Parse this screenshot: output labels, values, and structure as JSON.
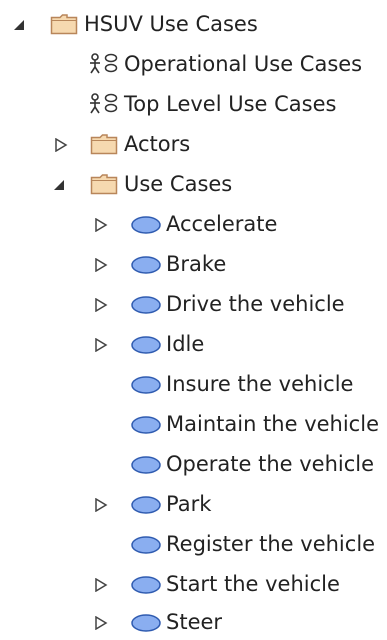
{
  "tree": {
    "root": {
      "label": "HSUV Use Cases",
      "expanded": true,
      "icon": "folder-icon",
      "children": {
        "operational": {
          "label": "Operational Use Cases",
          "icon": "use-case-diagram-icon"
        },
        "top_level": {
          "label": "Top Level Use Cases",
          "icon": "use-case-diagram-icon"
        },
        "actors": {
          "label": "Actors",
          "icon": "folder-icon",
          "expanded": false
        },
        "use_cases": {
          "label": "Use Cases",
          "icon": "folder-icon",
          "expanded": true,
          "items": [
            {
              "label": "Accelerate",
              "has_children": true
            },
            {
              "label": "Brake",
              "has_children": true
            },
            {
              "label": "Drive the vehicle",
              "has_children": true
            },
            {
              "label": "Idle",
              "has_children": true
            },
            {
              "label": "Insure the vehicle",
              "has_children": false
            },
            {
              "label": "Maintain the vehicle",
              "has_children": false
            },
            {
              "label": "Operate the vehicle",
              "has_children": false
            },
            {
              "label": "Park",
              "has_children": true
            },
            {
              "label": "Register the vehicle",
              "has_children": false
            },
            {
              "label": "Start the vehicle",
              "has_children": true
            },
            {
              "label": "Steer",
              "has_children": true
            }
          ]
        }
      }
    }
  },
  "colors": {
    "folder_fill": "#f6d9b0",
    "folder_stroke": "#b8865a",
    "use_case_fill": "#8aaef0",
    "use_case_stroke": "#2f5bb0",
    "toggle_stroke": "#444444",
    "toggle_fill": "#333333",
    "text": "#222222"
  }
}
